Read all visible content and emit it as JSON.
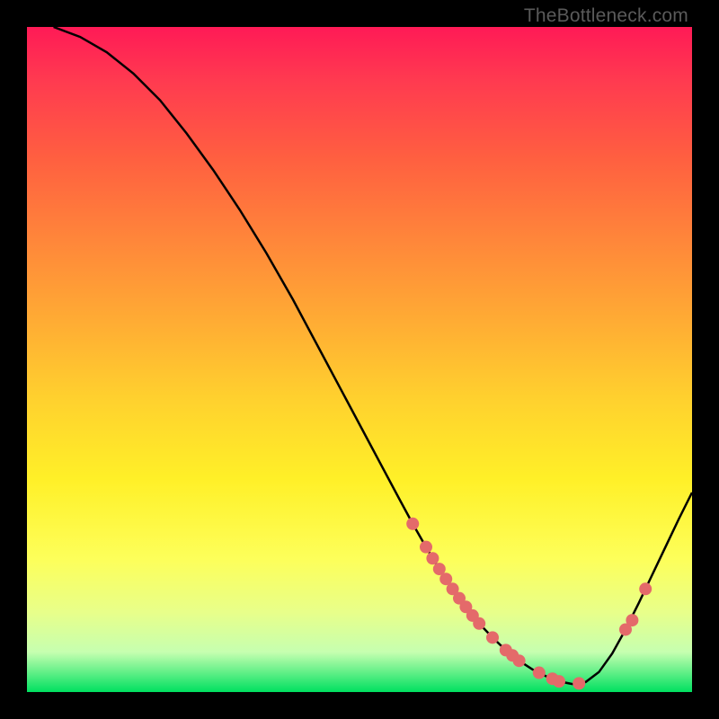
{
  "watermark": "TheBottleneck.com",
  "chart_data": {
    "type": "line",
    "title": "",
    "xlabel": "",
    "ylabel": "",
    "xlim": [
      0,
      100
    ],
    "ylim": [
      0,
      100
    ],
    "series": [
      {
        "name": "curve",
        "x": [
          4,
          8,
          12,
          16,
          20,
          24,
          28,
          32,
          36,
          40,
          44,
          48,
          52,
          56,
          58,
          60,
          62,
          64,
          66,
          68,
          70,
          72,
          74,
          76,
          78,
          80,
          82,
          84,
          86,
          88,
          90,
          92,
          94,
          96,
          98,
          100
        ],
        "y": [
          100,
          98.5,
          96.2,
          93.0,
          89.0,
          84.0,
          78.5,
          72.5,
          66.0,
          59.0,
          51.5,
          44.0,
          36.5,
          29.0,
          25.3,
          21.8,
          18.5,
          15.5,
          12.8,
          10.3,
          8.2,
          6.3,
          4.7,
          3.4,
          2.4,
          1.6,
          1.2,
          1.5,
          3.0,
          5.8,
          9.4,
          13.4,
          17.6,
          21.8,
          26.0,
          30.0
        ]
      }
    ],
    "points": {
      "name": "markers",
      "x": [
        58,
        60,
        61,
        62,
        63,
        64,
        65,
        66,
        67,
        68,
        70,
        72,
        73,
        74,
        77,
        79,
        80,
        83,
        90,
        91,
        93
      ],
      "y": [
        25.3,
        21.8,
        20.1,
        18.5,
        17.0,
        15.5,
        14.1,
        12.8,
        11.5,
        10.3,
        8.2,
        6.3,
        5.5,
        4.7,
        2.9,
        2.0,
        1.6,
        1.3,
        9.4,
        10.8,
        15.5
      ]
    },
    "marker_color": "#e46a6a",
    "curve_color": "#000000"
  }
}
